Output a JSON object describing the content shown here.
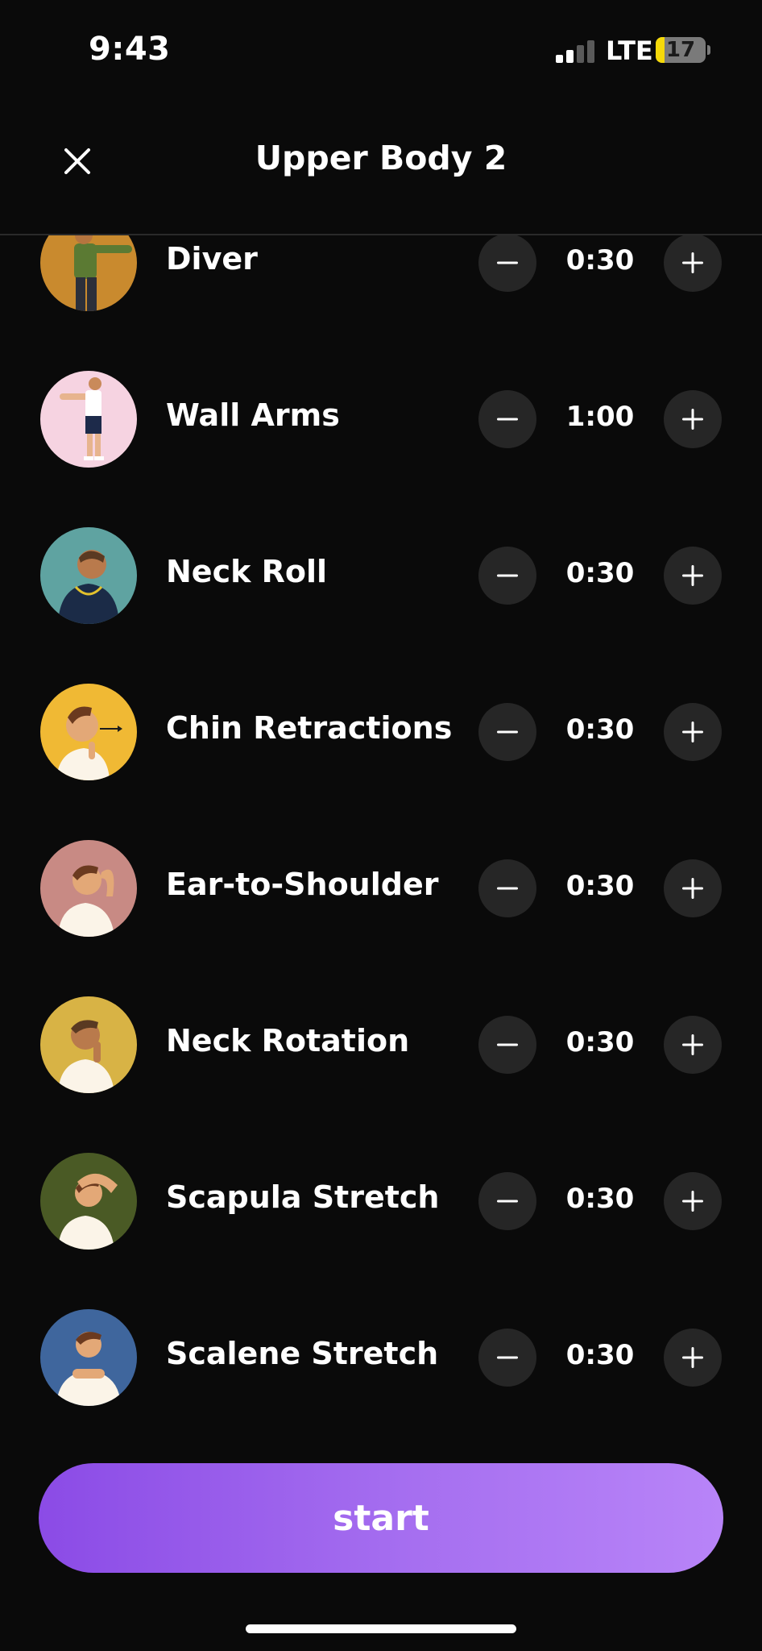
{
  "status_bar": {
    "time": "9:43",
    "network": "LTE",
    "battery": "17",
    "battery_level": 0.17
  },
  "header": {
    "title": "Upper Body 2",
    "close_icon": "close-icon"
  },
  "exercises": [
    {
      "name": "Diver",
      "duration": "0:30",
      "thumb_color": "#c98a2e"
    },
    {
      "name": "Wall Arms",
      "duration": "1:00",
      "thumb_color": "#f6d3e1"
    },
    {
      "name": "Neck Roll",
      "duration": "0:30",
      "thumb_color": "#5fa3a1"
    },
    {
      "name": "Chin Retractions",
      "duration": "0:30",
      "thumb_color": "#f0b934"
    },
    {
      "name": "Ear-to-Shoulder",
      "duration": "0:30",
      "thumb_color": "#c88a84"
    },
    {
      "name": "Neck Rotation",
      "duration": "0:30",
      "thumb_color": "#d8b345"
    },
    {
      "name": "Scapula Stretch",
      "duration": "0:30",
      "thumb_color": "#4a5a25"
    },
    {
      "name": "Scalene Stretch",
      "duration": "0:30",
      "thumb_color": "#3f669d"
    }
  ],
  "start_button": {
    "label": "start"
  },
  "colors": {
    "background": "#0a0a0a",
    "control_bg": "#262626",
    "accent_start": "#8b4be6",
    "accent_end": "#b884f8"
  }
}
